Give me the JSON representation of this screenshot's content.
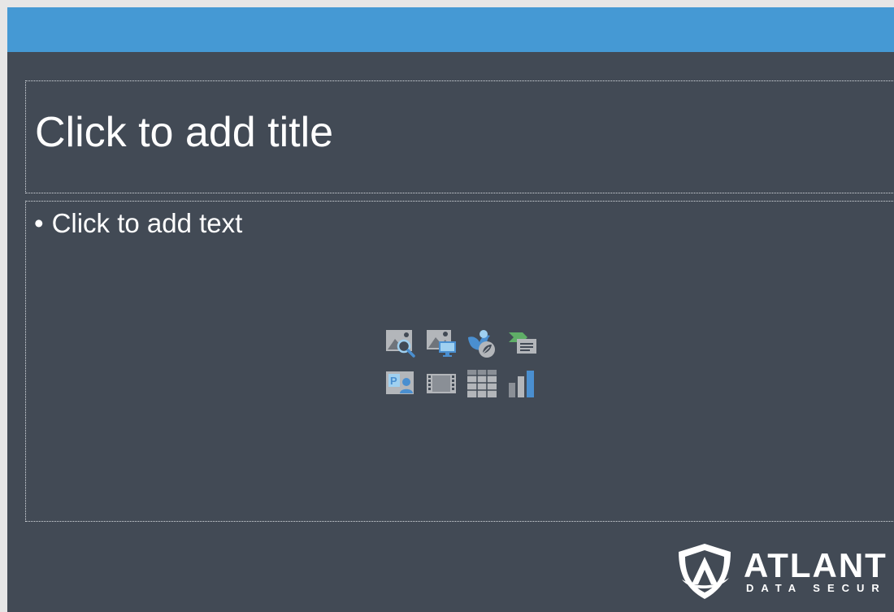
{
  "slide": {
    "title_placeholder": "Click to add title",
    "body_bullet": "•",
    "body_placeholder": "Click to add text"
  },
  "insert_icons": [
    "online-pictures-icon",
    "pictures-icon",
    "icons-icon",
    "smartart-icon",
    "stock-images-icon",
    "video-icon",
    "table-icon",
    "chart-icon"
  ],
  "logo": {
    "name": "ATLANT",
    "tagline": "DATA SECUR"
  },
  "colors": {
    "top_bar": "#4599d4",
    "slide_bg": "#424a55",
    "icon_gray": "#b3b6ba",
    "icon_blue": "#4a8fd0",
    "icon_green": "#5fae67"
  }
}
